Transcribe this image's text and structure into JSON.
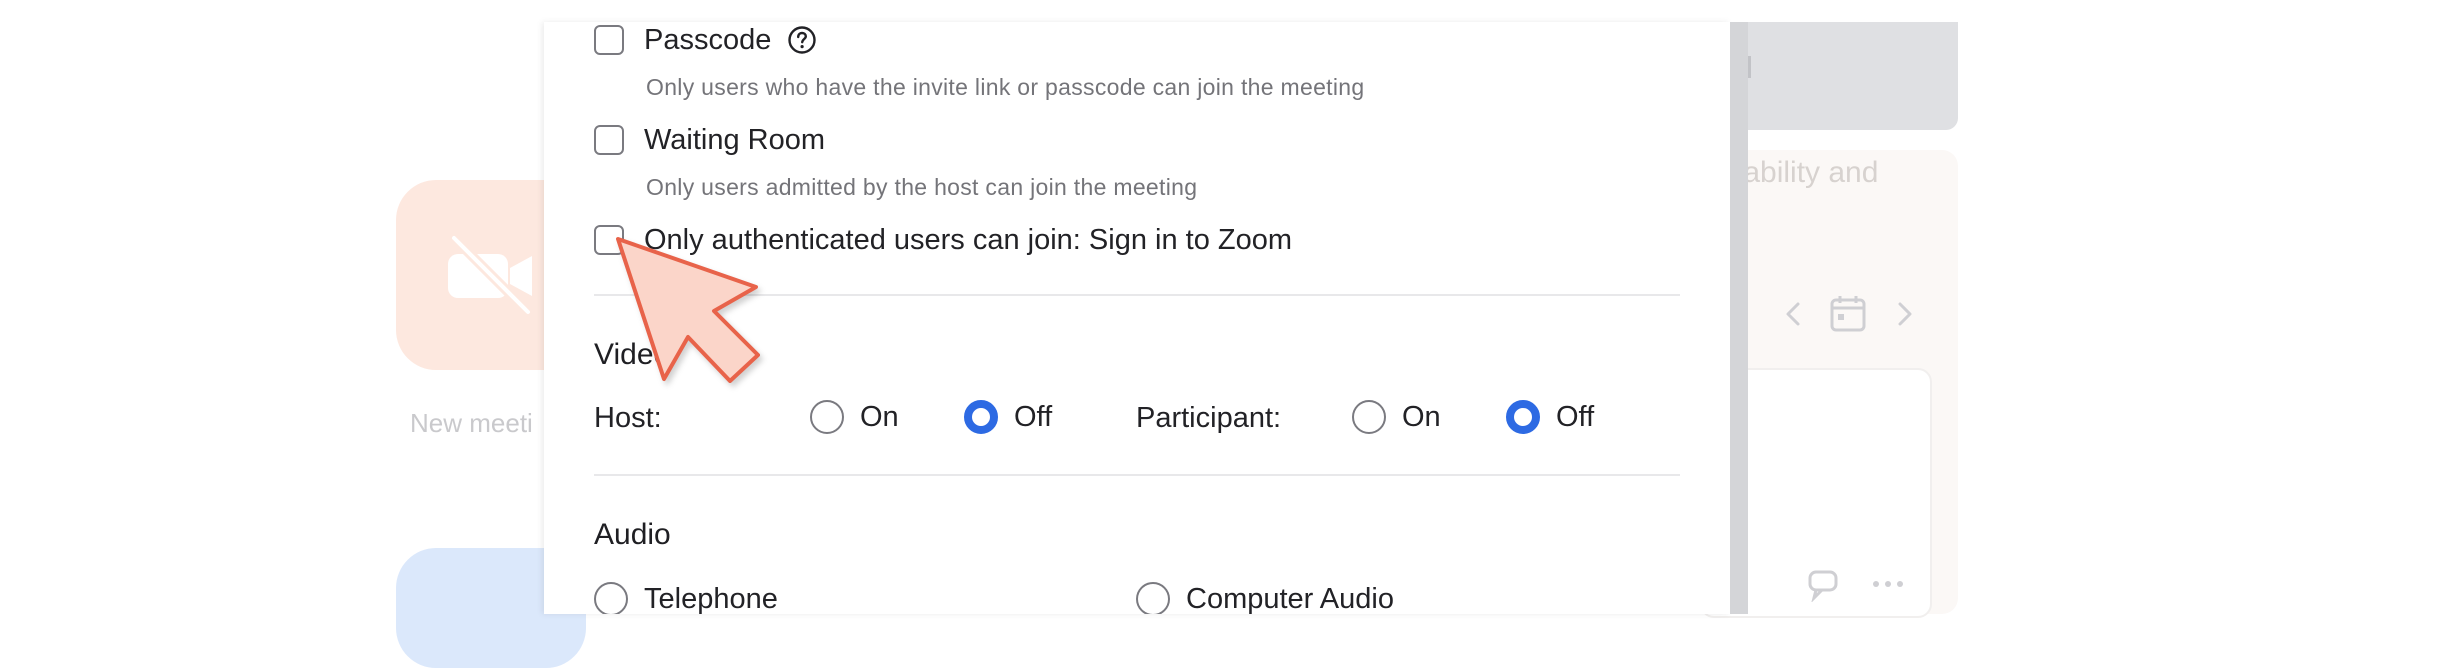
{
  "background_app": {
    "tile_new_meeting_label": "New meeti",
    "right_panel_text": "ilability and"
  },
  "security": {
    "passcode": {
      "label": "Passcode",
      "checked": false,
      "hint": "Only users who have the invite link or passcode can join the meeting"
    },
    "waiting_room": {
      "label": "Waiting Room",
      "checked": false,
      "hint": "Only users admitted by the host can join the meeting"
    },
    "authenticated_only": {
      "label": "Only authenticated users can join: Sign in to Zoom",
      "checked": false
    }
  },
  "video": {
    "title": "Video",
    "host_label": "Host:",
    "participant_label": "Participant:",
    "on_label": "On",
    "off_label": "Off",
    "host_selected": "Off",
    "participant_selected": "Off"
  },
  "audio": {
    "title": "Audio",
    "options": [
      "Telephone",
      "Computer Audio"
    ]
  },
  "colors": {
    "accent": "#2d6ae3",
    "pointer_fill": "#fbd5c9",
    "pointer_stroke": "#e8634a"
  }
}
